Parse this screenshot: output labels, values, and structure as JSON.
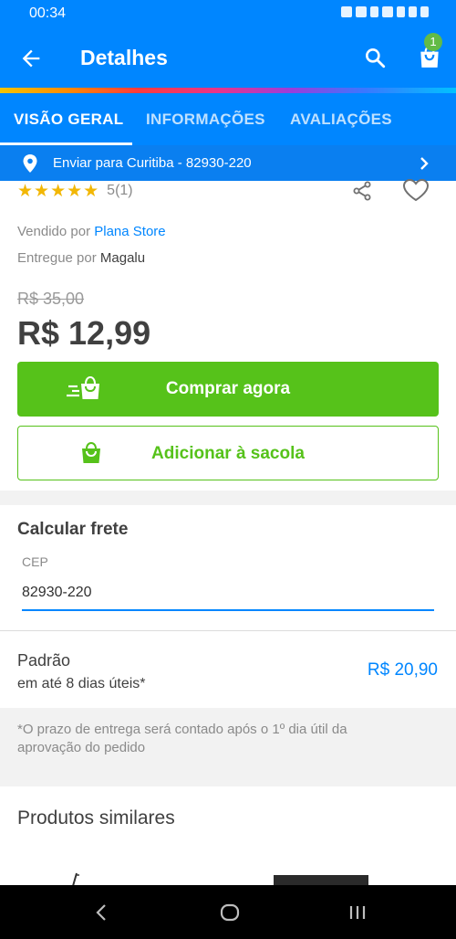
{
  "status_bar": {
    "time": "00:34"
  },
  "app_bar": {
    "title": "Detalhes",
    "cart_count": "1"
  },
  "tabs": [
    {
      "label": "VISÃO GERAL",
      "active": true
    },
    {
      "label": "INFORMAÇÕES",
      "active": false
    },
    {
      "label": "AVALIAÇÕES",
      "active": false
    }
  ],
  "shipping_bar": {
    "text": "Enviar para Curitiba - 82930-220"
  },
  "product": {
    "rating_stars": 5,
    "rating_text": "5(1)",
    "sold_by_prefix": "Vendido por",
    "sold_by": "Plana Store",
    "delivered_by_prefix": "Entregue por",
    "delivered_by": "Magalu",
    "old_price": "R$ 35,00",
    "price": "R$ 12,99"
  },
  "actions": {
    "buy_now": "Comprar agora",
    "add_to_bag": "Adicionar à sacola"
  },
  "freight": {
    "title": "Calcular frete",
    "cep_label": "CEP",
    "cep_value": "82930-220",
    "option_name": "Padrão",
    "option_days": "em até 8 dias úteis*",
    "option_price": "R$ 20,90",
    "note": "*O prazo de entrega será contado após o 1º dia útil da aprovação do pedido"
  },
  "similar": {
    "title": "Produtos similares"
  },
  "colors": {
    "primary_blue": "#0086ff",
    "buy_green": "#56c21a",
    "star_yellow": "#f2b705"
  },
  "icons": [
    "arrow-back-icon",
    "search-icon",
    "shopping-bag-icon",
    "location-pin-icon",
    "chevron-right-icon",
    "star-icon",
    "share-icon",
    "heart-icon",
    "fast-cart-icon",
    "back-nav-icon",
    "home-nav-icon",
    "recents-nav-icon"
  ]
}
